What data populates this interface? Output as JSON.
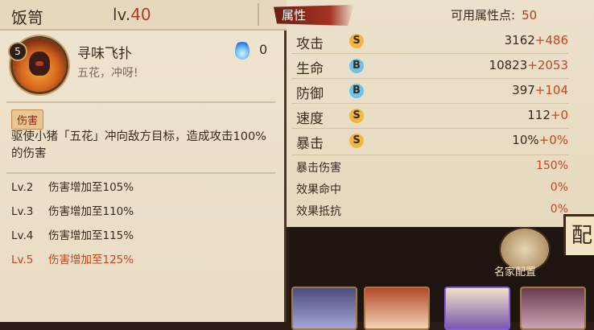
{
  "colors": {
    "accent": "#b53a24",
    "bonus": "#c8461d",
    "panel": "#ece1cb"
  },
  "header": {
    "shikigami_name": "饭笥",
    "level_prefix": "lv.",
    "level": "40"
  },
  "skill": {
    "level_badge": "5",
    "title": "寻味飞扑",
    "subtitle": "五花，冲呀!",
    "fire_icon": "blue-fire-icon",
    "fire_cost": "0",
    "tag": "伤害",
    "description": "驱使小猪「五花」冲向敌方目标，造成攻击100%的伤害",
    "levels": [
      {
        "lv": "Lv.2",
        "text": "伤害增加至105%"
      },
      {
        "lv": "Lv.3",
        "text": "伤害增加至110%"
      },
      {
        "lv": "Lv.4",
        "text": "伤害增加至115%"
      },
      {
        "lv": "Lv.5",
        "text": "伤害增加至125%"
      }
    ]
  },
  "attributes": {
    "tab_label": "属性",
    "points_label": "可用属性点:",
    "points": "50",
    "main": [
      {
        "label": "攻击",
        "grade": "S",
        "base": "3162",
        "bonus": "+486"
      },
      {
        "label": "生命",
        "grade": "B",
        "base": "10823",
        "bonus": "+2053"
      },
      {
        "label": "防御",
        "grade": "B",
        "base": "397",
        "bonus": "+104"
      },
      {
        "label": "速度",
        "grade": "S",
        "base": "112",
        "bonus": "+0"
      },
      {
        "label": "暴击",
        "grade": "S",
        "base": "10%",
        "bonus": "+0%"
      }
    ],
    "extra": [
      {
        "label": "暴击伤害",
        "value": "150%"
      },
      {
        "label": "效果命中",
        "value": "0%"
      },
      {
        "label": "效果抵抗",
        "value": "0%"
      }
    ]
  },
  "bottom": {
    "fame_label": "名家配置",
    "corner_char": "配"
  }
}
